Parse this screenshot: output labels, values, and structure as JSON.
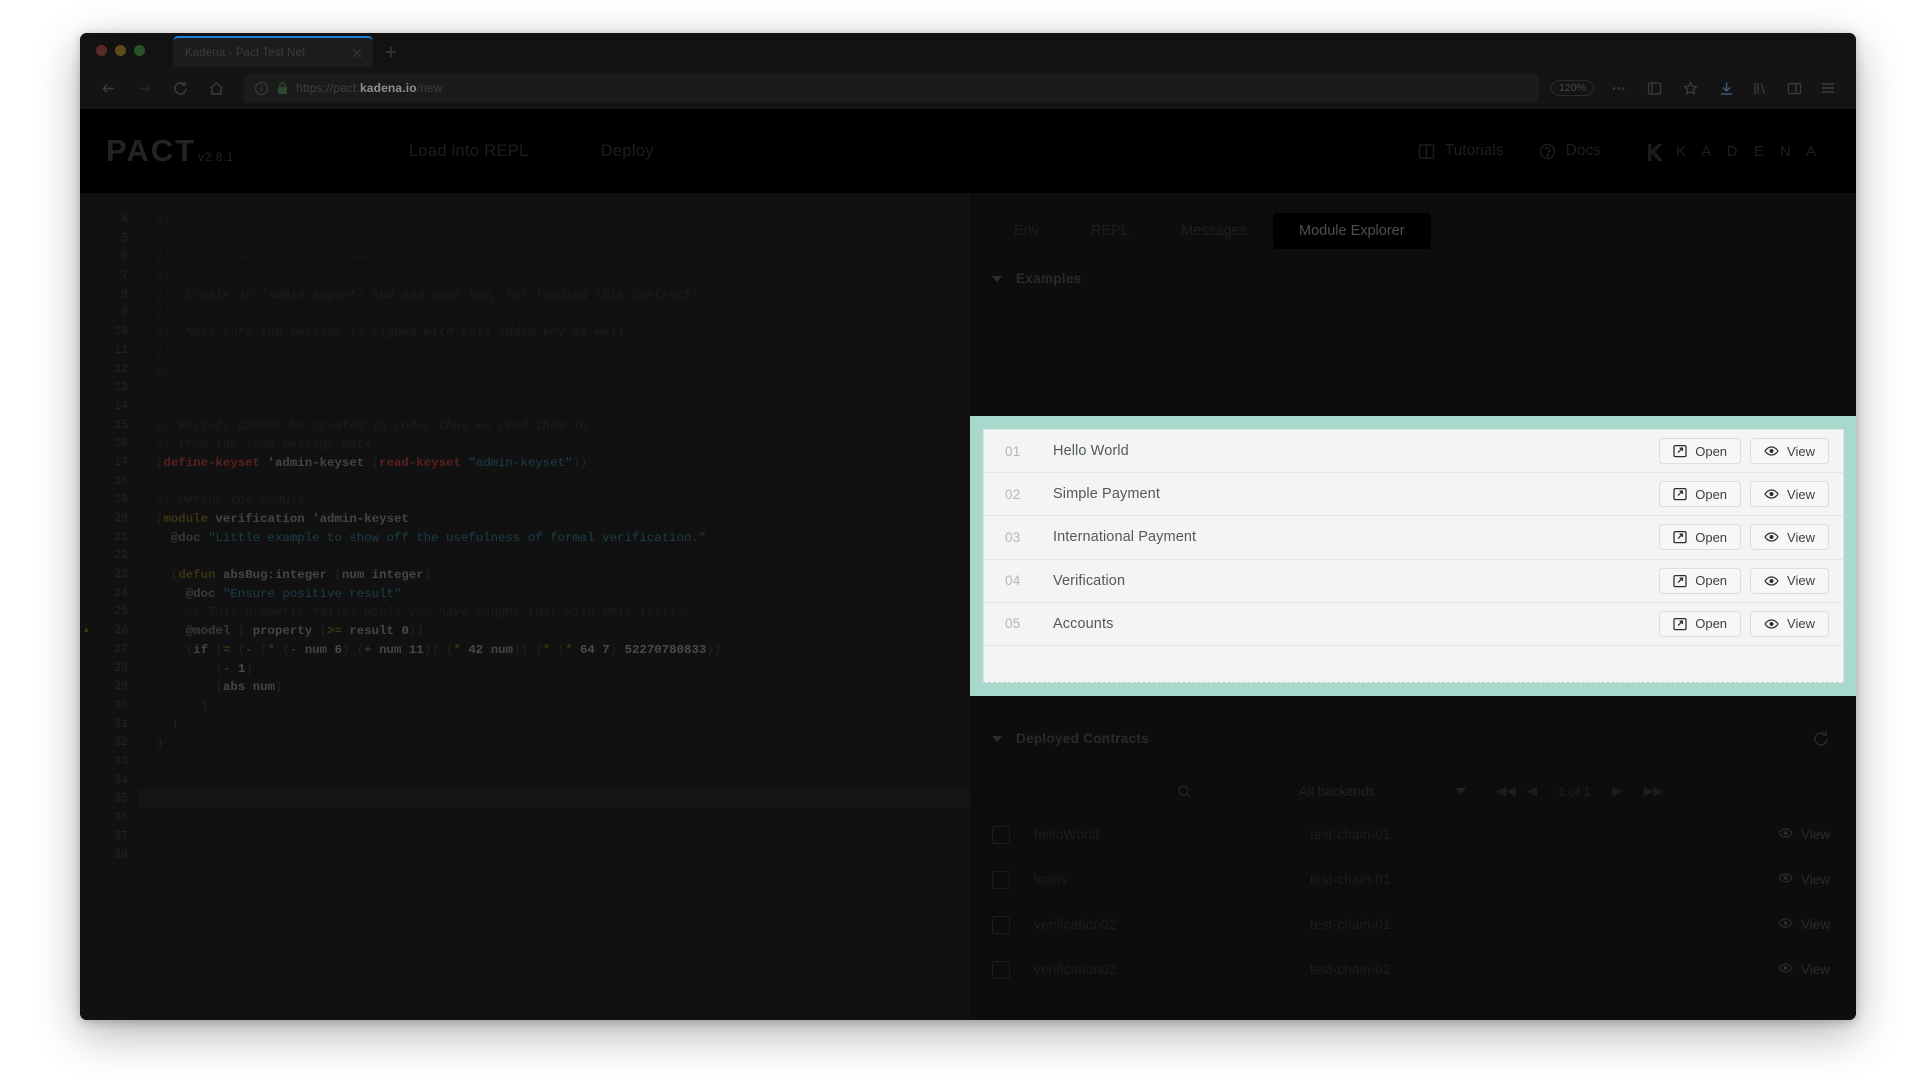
{
  "browser": {
    "tab": {
      "title": "Kadena - Pact Test Net",
      "close_icon": "close-icon"
    },
    "newtab_label": "+",
    "url": {
      "scheme": "https://pact.",
      "host": "kadena.io",
      "path": "/new",
      "full": "https://pact.kadena.io/new"
    },
    "zoom_level": "120%"
  },
  "app_header": {
    "logo": "PACT",
    "version": "v2.8.1",
    "nav": [
      {
        "label": "Load into REPL",
        "name": "load-into-repl-button"
      },
      {
        "label": "Deploy",
        "name": "deploy-button"
      }
    ],
    "right_nav": [
      {
        "label": "Tutorials",
        "icon": "book-icon"
      },
      {
        "label": "Docs",
        "icon": "help-circle-icon"
      }
    ],
    "brand": "K A D E N A"
  },
  "sidebar": {
    "tabs": [
      {
        "label": "Env",
        "active": false
      },
      {
        "label": "REPL",
        "active": false
      },
      {
        "label": "Messages",
        "active": false
      },
      {
        "label": "Module Explorer",
        "active": true
      }
    ],
    "examples": {
      "title": "Examples",
      "open_label": "Open",
      "view_label": "View",
      "items": [
        {
          "num": "01",
          "name": "Hello World"
        },
        {
          "num": "02",
          "name": "Simple Payment"
        },
        {
          "num": "03",
          "name": "International Payment"
        },
        {
          "num": "04",
          "name": "Verification"
        },
        {
          "num": "05",
          "name": "Accounts"
        }
      ]
    },
    "deployed": {
      "title": "Deployed Contracts",
      "refresh_icon": "refresh-icon",
      "backend_filter": "All backends",
      "pagination": "1 of 1",
      "view_label": "View",
      "rows": [
        {
          "name": "helloWorld",
          "chain": "test-chain-01"
        },
        {
          "name": "loans",
          "chain": "test-chain-01"
        },
        {
          "name": "verification02",
          "chain": "test-chain-01"
        },
        {
          "name": "verification02",
          "chain": "test-chain-02"
        }
      ]
    }
  },
  "editor": {
    "first_line": 4,
    "lines": [
      {
        "n": 4,
        "html": "<span class='cm'>;;</span>"
      },
      {
        "n": 5,
        "html": ""
      },
      {
        "n": 6,
        "html": "<span class='cm'>;;---------------------------------</span>"
      },
      {
        "n": 7,
        "html": "<span class='cm'>;;</span>"
      },
      {
        "n": 8,
        "html": "<span class='cm'>;;  Create an 'admin-keyset' and add some key, for loading this contract!</span>"
      },
      {
        "n": 9,
        "html": "<span class='cm'>;;</span>"
      },
      {
        "n": 10,
        "html": "<span class='cm'>;;  Make sure the message is signed with this added key as well.</span>"
      },
      {
        "n": 11,
        "html": "<span class='cm'>;;</span>"
      },
      {
        "n": 12,
        "html": "<span class='cm'>;;---------------------------------</span>"
      },
      {
        "n": 13,
        "html": ""
      },
      {
        "n": 14,
        "html": ""
      },
      {
        "n": 15,
        "html": "<span class='cm'>;; Keysets cannot be created in code, thus we read them in</span>"
      },
      {
        "n": 16,
        "html": "<span class='cm'>;; from the load message data.</span>"
      },
      {
        "n": 17,
        "html": "<span class='pn'>(</span><span class='kw'>define-keyset</span> <span class='id'>'admin-keyset</span> <span class='pn'>(</span><span class='kw'>read-keyset</span> <span class='str'>\"admin-keyset\"</span><span class='pn'>))</span>"
      },
      {
        "n": 18,
        "html": ""
      },
      {
        "n": 19,
        "html": "<span class='cm'>;; Define the module.</span>"
      },
      {
        "n": 20,
        "html": "<span class='pn'>(</span><span class='kw2'>module</span> <span class='id'>verification</span> <span class='id'>'admin-keyset</span>"
      },
      {
        "n": 21,
        "html": "  <span class='at'>@doc</span> <span class='str'>\"Little example to show off the usefulness of formal verification.\"</span>"
      },
      {
        "n": 22,
        "html": ""
      },
      {
        "n": 23,
        "html": "  <span class='pn'>(</span><span class='kw2'>defun</span> <span class='id'>absBug:integer</span> <span class='pn'>(</span><span class='id'>num</span> <span class='id'>integer</span><span class='pn'>)</span>"
      },
      {
        "n": 24,
        "html": "    <span class='at'>@doc</span> <span class='str'>\"Ensure positive result\"</span>"
      },
      {
        "n": 25,
        "html": "    <span class='cm'>;; This property fails: Would you have caught that with unit tests?</span>"
      },
      {
        "n": 26,
        "html": "    <span class='at'>@model</span> <span class='pn'>[</span> <span class='id'>property</span> <span class='pn'>(</span><span class='kw2'>&gt;=</span> <span class='id'>result</span> <span class='num'>0</span><span class='pn'>)]</span>",
        "warn": true
      },
      {
        "n": 27,
        "html": "    <span class='pn'>(</span><span class='id'>if</span> <span class='pn'>(</span><span class='kw2'>=</span> <span class='pn'>(</span><span class='kw2'>-</span> <span class='pn'>(</span><span class='kw2'>*</span> <span class='pn'>(</span><span class='kw2'>-</span> <span class='id'>num</span> <span class='num'>6</span><span class='pn'>)</span> <span class='pn'>(</span><span class='kw2'>+</span> <span class='id'>num</span> <span class='num'>11</span><span class='pn'>))</span> <span class='pn'>(</span><span class='kw2'>*</span> <span class='num'>42</span> <span class='id'>num</span><span class='pn'>))</span> <span class='pn'>(</span><span class='kw2'>*</span> <span class='pn'>(</span><span class='kw2'>*</span> <span class='num'>64</span> <span class='num'>7</span><span class='pn'>)</span> <span class='num'>52270780833</span><span class='pn'>))</span>"
      },
      {
        "n": 28,
        "html": "        <span class='pn'>(</span><span class='kw2'>-</span> <span class='num'>1</span><span class='pn'>)</span>"
      },
      {
        "n": 29,
        "html": "        <span class='pn'>(</span><span class='id'>abs</span> <span class='id'>num</span><span class='pn'>)</span>"
      },
      {
        "n": 30,
        "html": "      <span class='pn'>)</span>"
      },
      {
        "n": 31,
        "html": "  <span class='pn'>)</span>"
      },
      {
        "n": 32,
        "html": "<span class='pn'>)</span>"
      },
      {
        "n": 33,
        "html": ""
      },
      {
        "n": 34,
        "html": ""
      },
      {
        "n": 35,
        "html": "",
        "current": true
      },
      {
        "n": 36,
        "html": ""
      },
      {
        "n": 37,
        "html": ""
      },
      {
        "n": 38,
        "html": ""
      }
    ]
  },
  "colors": {
    "highlight_teal": "#a9d8cc",
    "tab_accent": "#1b7fd4",
    "card_bg": "#f3f4f4"
  }
}
